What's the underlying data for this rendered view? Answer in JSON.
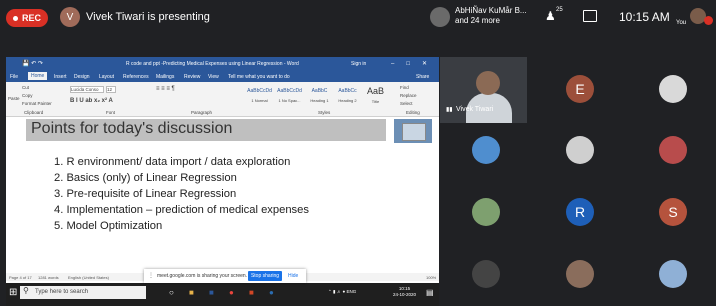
{
  "meet": {
    "rec_label": "REC",
    "presenter_initial": "V",
    "presenting_text": "Vivek Tiwari is presenting",
    "participants_line1": "AbHiÑav KuMår B...",
    "participants_line2": "and 24 more",
    "people_count": "25",
    "time": "10:15 AM",
    "you_label": "You",
    "colors": {
      "rec": "#d93025",
      "stop": "#1a73e8",
      "tile_bg": "#202124"
    }
  },
  "share": {
    "word_title": "R code and ppt -Predicting Medical Expenses using Linear Regression - Word",
    "sign_in": "Sign in",
    "tabs": [
      "File",
      "Home",
      "Insert",
      "Design",
      "Layout",
      "References",
      "Mailings",
      "Review",
      "View",
      "Tell me what you want to do",
      "Share"
    ],
    "ribbon": {
      "paste": "Paste",
      "cut": "Cut",
      "copy": "Copy",
      "format_painter": "Format Painter",
      "font": "Lucida Conso",
      "font_size": "12",
      "styles": [
        "AaBbCcDd",
        "AaBbCcDd",
        "AaBbC",
        "AaBbCc",
        "AaBbCcE",
        "AaB"
      ],
      "style_names": [
        "1 Normal",
        "1 No Spac...",
        "Heading 1",
        "Heading 2",
        "Title"
      ],
      "find": "Find",
      "replace": "Replace",
      "select": "Select",
      "groups": [
        "Clipboard",
        "Font",
        "Paragraph",
        "Styles",
        "Editing"
      ]
    },
    "slide_title": "Points for today's discussion",
    "points": [
      "1. R environment/ data import / data exploration",
      "2. Basics (only) of Linear Regression",
      "3. Pre-requisite of Linear Regression",
      "4. Implementation – prediction of medical expenses",
      "5. Model Optimization"
    ],
    "status": {
      "page": "Page 4 of 17",
      "words": "1281 words",
      "lang": "English (United States)",
      "zoom": "100%"
    },
    "sharing_msg": "meet.google.com is sharing your screen.",
    "stop_sharing": "Stop sharing",
    "hide": "Hide",
    "search_placeholder": "Type here to search",
    "tray_lang": "ENG",
    "tray_time": "10:15",
    "tray_date": "24-10-2020"
  },
  "tiles": [
    {
      "name": "Vivek Tiwari",
      "type": "video"
    },
    {
      "initial": "E",
      "color": "#9c4f3a"
    },
    {
      "initial": "",
      "color": "#d9d9d9"
    },
    {
      "initial": "",
      "color": "#4f8ecf"
    },
    {
      "initial": "",
      "color": "#cfcfcf"
    },
    {
      "initial": "",
      "color": "#b84c4c"
    },
    {
      "initial": "",
      "color": "#7ea06f"
    },
    {
      "initial": "R",
      "color": "#1e5fb8"
    },
    {
      "initial": "S",
      "color": "#b5533d"
    },
    {
      "initial": "",
      "color": "#444444"
    },
    {
      "initial": "",
      "color": "#8a6d5c"
    },
    {
      "initial": "",
      "color": "#8fb0d6"
    }
  ]
}
